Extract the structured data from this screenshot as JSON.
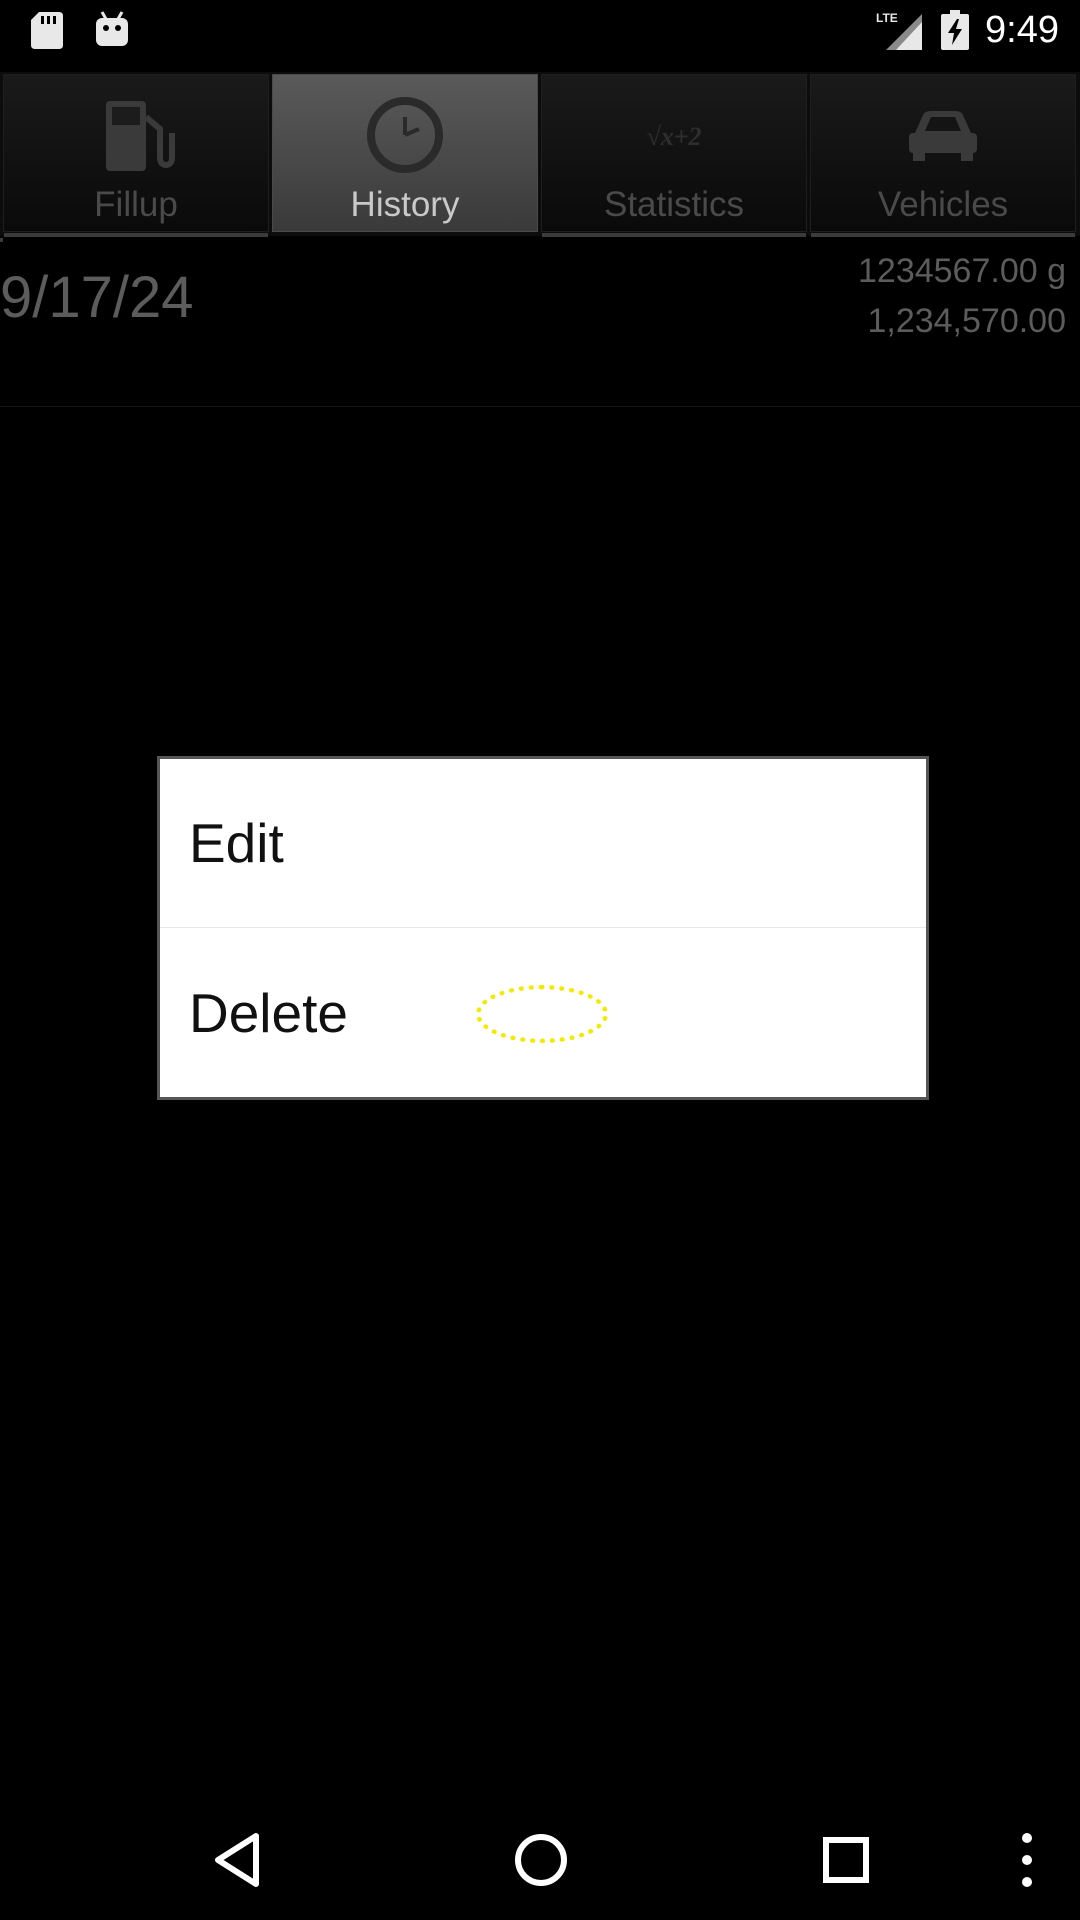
{
  "status_bar": {
    "time": "9:49",
    "network_label": "LTE",
    "icons": [
      "sd-card-icon",
      "android-icon",
      "lte-signal-icon",
      "battery-charging-icon"
    ]
  },
  "tabs": [
    {
      "label": "Fillup",
      "icon": "fuel-pump-icon",
      "active": false
    },
    {
      "label": "History",
      "icon": "clock-icon",
      "active": true
    },
    {
      "label": "Statistics",
      "icon": "formula-icon",
      "icon_text": "√x+2",
      "active": false
    },
    {
      "label": "Vehicles",
      "icon": "car-icon",
      "active": false
    }
  ],
  "history": {
    "rows": [
      {
        "date": "9/17/24",
        "amount": "1234567.00 g",
        "odometer": "1,234,570.00"
      }
    ]
  },
  "context_menu": {
    "items": [
      {
        "label": "Edit"
      },
      {
        "label": "Delete"
      }
    ]
  },
  "nav_bar": {
    "buttons": [
      "back-icon",
      "home-icon",
      "recents-icon",
      "overflow-menu-icon"
    ]
  },
  "colors": {
    "background": "#000000",
    "active_tab": "#4a4a4a",
    "dialog_bg": "#ffffff",
    "touch_indicator": "#f2ea00",
    "muted_text": "#5c5c5c"
  }
}
